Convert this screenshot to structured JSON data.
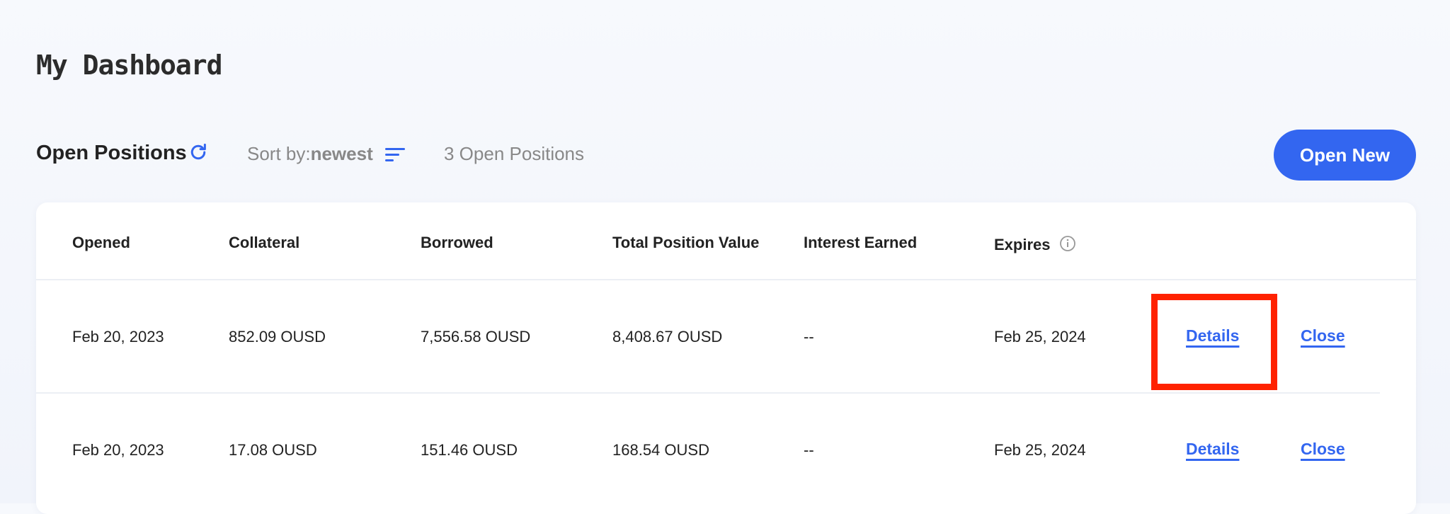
{
  "header": {
    "title": "My Dashboard"
  },
  "toolbar": {
    "section_title": "Open Positions",
    "sort_label": "Sort by:",
    "sort_value": "newest",
    "count_text": "3 Open Positions",
    "open_new_label": "Open New"
  },
  "table": {
    "columns": [
      "Opened",
      "Collateral",
      "Borrowed",
      "Total Position Value",
      "Interest Earned",
      "Expires"
    ],
    "rows": [
      {
        "opened": "Feb 20, 2023",
        "collateral": "852.09 OUSD",
        "borrowed": "7,556.58 OUSD",
        "total": "8,408.67 OUSD",
        "interest": "--",
        "expires": "Feb 25, 2024",
        "details_label": "Details",
        "close_label": "Close"
      },
      {
        "opened": "Feb 20, 2023",
        "collateral": "17.08 OUSD",
        "borrowed": "151.46 OUSD",
        "total": "168.54 OUSD",
        "interest": "--",
        "expires": "Feb 25, 2024",
        "details_label": "Details",
        "close_label": "Close"
      }
    ]
  },
  "colors": {
    "accent": "#3366f0",
    "highlight": "#ff2200",
    "muted_text": "#888888"
  },
  "icons": [
    "refresh-icon",
    "sort-icon",
    "info-icon"
  ]
}
